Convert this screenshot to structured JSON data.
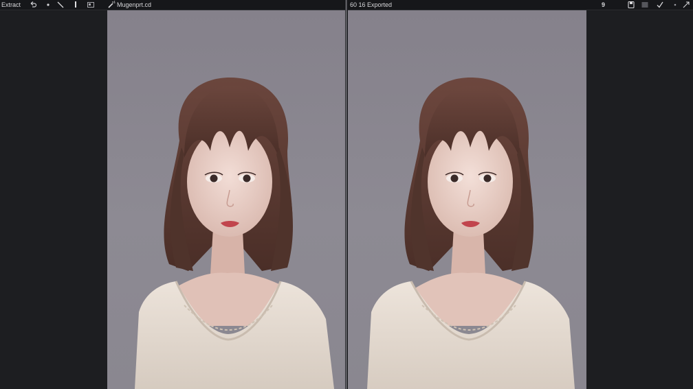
{
  "toolbar": {
    "left_label": "Extract",
    "file_label": "Mugenprt.cd",
    "compare_label": "60 16 Exported",
    "page_indicator": "9"
  },
  "icons": {
    "undo": "undo-icon",
    "dot": "dot-tool-icon",
    "line": "line-tool-icon",
    "bar": "bar-tool-icon",
    "frame": "frame-icon",
    "wand": "wand-icon",
    "save": "save-icon",
    "panel": "panel-icon",
    "check": "check-icon",
    "expand": "expand-icon"
  },
  "colors": {
    "app_bg": "#1d1e21",
    "toolbar_bg": "#16171a",
    "canvas_bg": "#8a8790",
    "hair": "#5a3a32",
    "sweater": "#e7ddd3"
  }
}
